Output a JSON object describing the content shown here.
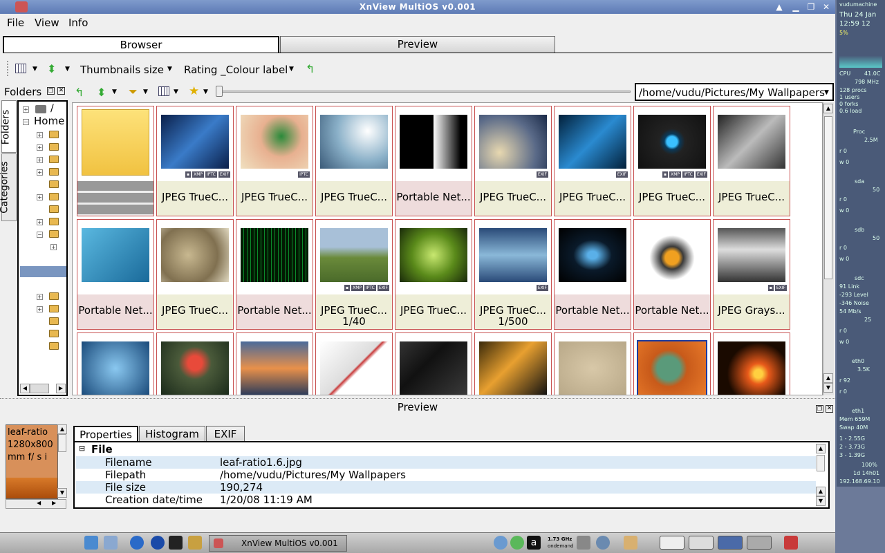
{
  "window": {
    "title": "XnView MultiOS v0.001"
  },
  "menu": [
    "File",
    "View",
    "Info"
  ],
  "tabs": {
    "browser": "Browser",
    "preview": "Preview"
  },
  "toolbar": {
    "thumb_size": "Thumbnails size",
    "rating": "Rating _Colour label"
  },
  "folders": {
    "header": "Folders",
    "vtab_folders": "Folders",
    "vtab_categories": "Categories",
    "root": "/",
    "home": "Home"
  },
  "path": "/home/vudu/Pictures/My Wallpapers",
  "grid": {
    "row1": [
      {
        "label": "",
        "badges": []
      },
      {
        "label": "JPEG TrueC...",
        "badges": [
          "▪",
          "XMP",
          "IPTC",
          "EXIF"
        ]
      },
      {
        "label": "JPEG TrueC...",
        "badges": [
          "IPTC"
        ]
      },
      {
        "label": "JPEG TrueC...",
        "badges": []
      },
      {
        "label": "Portable Net...",
        "badges": []
      },
      {
        "label": "JPEG TrueC...",
        "badges": [
          "EXIF"
        ]
      },
      {
        "label": "JPEG TrueC...",
        "badges": [
          "EXIF"
        ]
      },
      {
        "label": "JPEG TrueC...",
        "badges": [
          "▪",
          "XMP",
          "IPTC",
          "EXIF"
        ]
      },
      {
        "label": "JPEG TrueC...",
        "badges": []
      }
    ],
    "row2": [
      {
        "label": "Portable Net...",
        "sub": "",
        "badges": []
      },
      {
        "label": "JPEG TrueC...",
        "sub": "",
        "badges": []
      },
      {
        "label": "Portable Net...",
        "sub": "",
        "badges": []
      },
      {
        "label": "JPEG TrueC...",
        "sub": "1/40",
        "badges": [
          "▪",
          "XMP",
          "IPTC",
          "EXIF"
        ]
      },
      {
        "label": "JPEG TrueC...",
        "sub": "",
        "badges": []
      },
      {
        "label": "JPEG TrueC...",
        "sub": "1/500",
        "badges": [
          "EXIF"
        ]
      },
      {
        "label": "Portable Net...",
        "sub": "",
        "badges": []
      },
      {
        "label": "Portable Net...",
        "sub": "",
        "badges": []
      },
      {
        "label": "JPEG Grays...",
        "sub": "",
        "badges": [
          "▪",
          "EXIF"
        ]
      }
    ]
  },
  "preview": {
    "title": "Preview",
    "thumb_text": "leaf-ratio 1280x800 mm f/ s i",
    "tabs": [
      "Properties",
      "Histogram",
      "EXIF"
    ],
    "section": "File",
    "props": [
      {
        "key": "Filename",
        "value": "leaf-ratio1.6.jpg"
      },
      {
        "key": "Filepath",
        "value": "/home/vudu/Pictures/My Wallpapers"
      },
      {
        "key": "File size",
        "value": "190,274"
      },
      {
        "key": "Creation date/time",
        "value": "1/20/08 11:19 AM"
      }
    ]
  },
  "taskbar": {
    "task": "XnView MultiOS v0.001",
    "cpu": "1.73 GHz",
    "governor": "ondemand"
  },
  "conky": {
    "host": "vudumachine",
    "date": "Thu 24 Jan",
    "time": "12:59 12",
    "cpu_pct": "5%",
    "cpu_label": "CPU",
    "cpu_temp": "41.0C",
    "cpu_freq": "798 MHz",
    "procs": "128 procs",
    "users": "1 users",
    "forks": "0 forks",
    "load": "0.6 load",
    "proc": "Proc",
    "proc_mem": "2.5M",
    "disk_r": "r 0",
    "disk_w": "w 0",
    "sda": "sda",
    "sda_val": "50",
    "sdb": "sdb",
    "sdb_val": "50",
    "sdc": "sdc",
    "link": "91 Link",
    "level": "-293 Level",
    "noise": "-346 Noise",
    "rate": "54 Mb/s",
    "rate2": "25",
    "eth0": "eth0",
    "eth0_val": "3.5K",
    "r92": "r 92",
    "eth1": "eth1",
    "mem": "Mem 659M",
    "swap": "Swap 40M",
    "g1": "1 - 2.55G",
    "g2": "2 - 3.73G",
    "g3": "3 - 1.39G",
    "batt": "100%",
    "uptime": "1d 14h01",
    "ip": "192.168.69.10"
  }
}
